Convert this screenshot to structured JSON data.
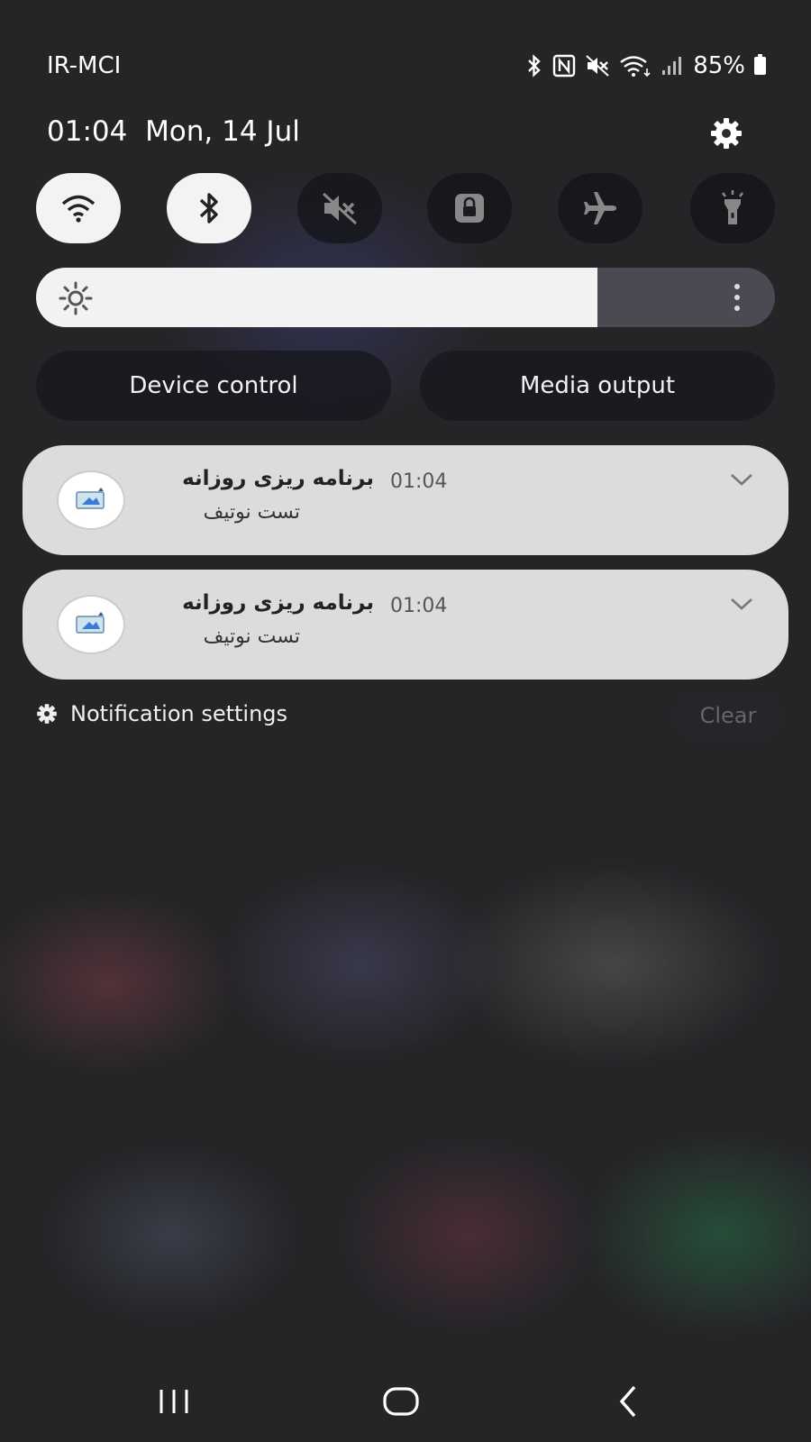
{
  "status_bar": {
    "carrier": "IR-MCI",
    "battery": "85%",
    "icons": [
      "bluetooth-icon",
      "nfc-icon",
      "mute-icon",
      "wifi-icon",
      "signal-icon",
      "battery-icon"
    ]
  },
  "header": {
    "time": "01:04",
    "date": "Mon, 14 Jul"
  },
  "quick_settings": [
    {
      "name": "wifi",
      "icon": "wifi-icon",
      "state": "on"
    },
    {
      "name": "bluetooth",
      "icon": "bluetooth-icon",
      "state": "on"
    },
    {
      "name": "sound",
      "icon": "mute-icon",
      "state": "off"
    },
    {
      "name": "rotation-lock",
      "icon": "lock-icon",
      "state": "off"
    },
    {
      "name": "airplane-mode",
      "icon": "airplane-icon",
      "state": "off"
    },
    {
      "name": "flashlight",
      "icon": "flashlight-icon",
      "state": "off"
    }
  ],
  "brightness": {
    "level": 0.76
  },
  "controls": {
    "device_control": "Device control",
    "media_output": "Media output"
  },
  "notifications": [
    {
      "app_title": "برنامه ریزی روزانه",
      "time": "01:04",
      "body": "تست نوتیف"
    },
    {
      "app_title": "برنامه ریزی روزانه",
      "time": "01:04",
      "body": "تست نوتیف"
    }
  ],
  "footer": {
    "notification_settings": "Notification settings",
    "clear": "Clear"
  },
  "colors": {
    "tile_on": "#f3f3f3",
    "tile_off": "#18181e",
    "notification_card": "#dcdcdf"
  }
}
